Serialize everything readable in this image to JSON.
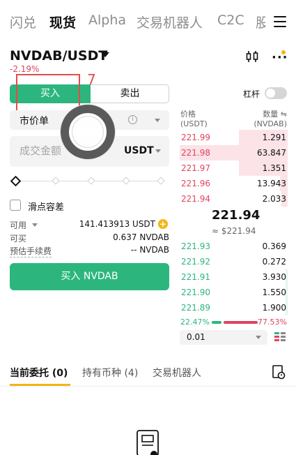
{
  "nav": {
    "tabs": [
      "闪兑",
      "现货",
      "Alpha",
      "交易机器人",
      "C2C",
      "股"
    ],
    "active": "现货"
  },
  "pair": {
    "symbol": "NVDAB/USDT",
    "change": "-2.19%"
  },
  "trade": {
    "buy_label": "买入",
    "sell_label": "卖出",
    "annotation_number": "7",
    "order_type": "市价单",
    "amount_placeholder": "成交金额",
    "amount_unit": "USDT",
    "slippage_label": "滑点容差",
    "available_label": "可用",
    "available_value": "141.413913 USDT",
    "can_buy_label": "可买",
    "can_buy_value": "0.637 NVDAB",
    "fee_label": "预估手续费",
    "fee_value": "-- NVDAB",
    "buy_button": "买入 NVDAB"
  },
  "orderbook": {
    "leverage_label": "杠杆",
    "price_header": "价格",
    "price_unit": "(USDT)",
    "qty_header": "数量",
    "qty_unit": "(NVDAB)",
    "asks": [
      {
        "price": "221.99",
        "qty": "1.291",
        "depth": 0.45
      },
      {
        "price": "221.98",
        "qty": "63.847",
        "depth": 1.0
      },
      {
        "price": "221.97",
        "qty": "1.351",
        "depth": 0.45
      },
      {
        "price": "221.96",
        "qty": "13.943",
        "depth": 0.07
      },
      {
        "price": "221.94",
        "qty": "2.033",
        "depth": 0.06
      }
    ],
    "mid_price": "221.94",
    "mid_fiat": "≈ $221.94",
    "bids": [
      {
        "price": "221.93",
        "qty": "0.369",
        "depth": 0.0
      },
      {
        "price": "221.92",
        "qty": "0.272",
        "depth": 0.0
      },
      {
        "price": "221.91",
        "qty": "3.930",
        "depth": 0.02
      },
      {
        "price": "221.90",
        "qty": "1.550",
        "depth": 0.02
      },
      {
        "price": "221.89",
        "qty": "1.900",
        "depth": 0.02
      }
    ],
    "buy_ratio": "22.47%",
    "sell_ratio": "77.53%",
    "buy_ratio_value": 22.47,
    "precision": "0.01"
  },
  "bottom_tabs": [
    "当前委托 (0)",
    "持有币种 (4)",
    "交易机器人"
  ],
  "colors": {
    "green": "#2cb67d",
    "red": "#e0445d",
    "accent": "#f3b514"
  }
}
